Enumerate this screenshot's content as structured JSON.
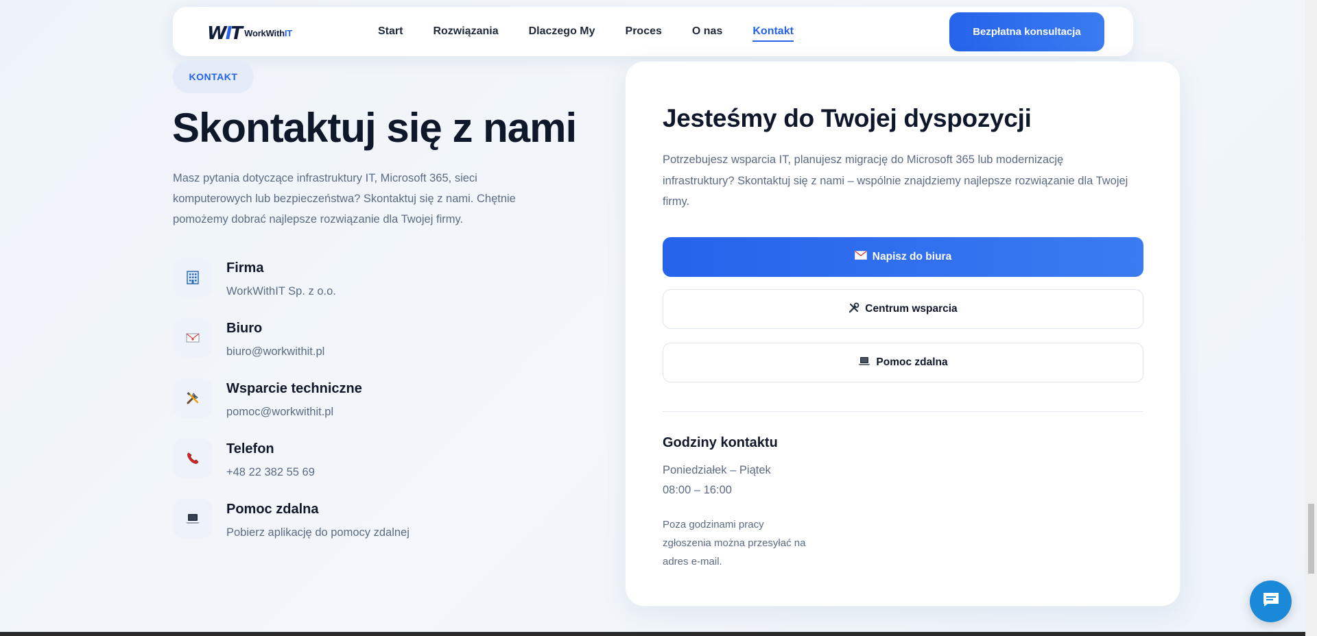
{
  "header": {
    "logo_mark": "WIT",
    "logo_name_part1": "WorkWith",
    "logo_name_part2": "IT",
    "nav": [
      "Start",
      "Rozwiązania",
      "Dlaczego My",
      "Proces",
      "O nas",
      "Kontakt"
    ],
    "active_nav": "Kontakt",
    "cta_label": "Bezpłatna konsultacja"
  },
  "left": {
    "badge": "KONTAKT",
    "title": "Skontaktuj się z nami",
    "intro": "Masz pytania dotyczące infrastruktury IT, Microsoft 365, sieci komputerowych lub bezpieczeństwa? Skontaktuj się z nami. Chętnie pomożemy dobrać najlepsze rozwiązanie dla Twojej firmy.",
    "contacts": [
      {
        "label": "Firma",
        "value": "WorkWithIT Sp. z o.o.",
        "icon": "office-building-icon"
      },
      {
        "label": "Biuro",
        "value": "biuro@workwithit.pl",
        "icon": "envelope-icon"
      },
      {
        "label": "Wsparcie techniczne",
        "value": "pomoc@workwithit.pl",
        "icon": "tools-icon"
      },
      {
        "label": "Telefon",
        "value": "+48 22 382 55 69",
        "icon": "phone-icon"
      },
      {
        "label": "Pomoc zdalna",
        "value": "Pobierz aplikację do pomocy zdalnej",
        "icon": "laptop-icon"
      }
    ]
  },
  "card": {
    "title": "Jesteśmy do Twojej dyspozycji",
    "description": "Potrzebujesz wsparcia IT, planujesz migrację do Microsoft 365 lub modernizację infrastruktury? Skontaktuj się z nami – wspólnie znajdziemy najlepsze rozwiązanie dla Twojej firmy.",
    "btn_office": "Napisz do biura",
    "btn_support": "Centrum wsparcia",
    "btn_remote": "Pomoc zdalna",
    "hours_title": "Godziny kontaktu",
    "hours_days": "Poniedziałek – Piątek",
    "hours_time": "08:00 – 16:00",
    "hours_note": "Poza godzinami pracy zgłoszenia można przesyłać na adres e-mail."
  },
  "colors": {
    "accent": "#2563eb",
    "chat": "#1a8ad8"
  }
}
